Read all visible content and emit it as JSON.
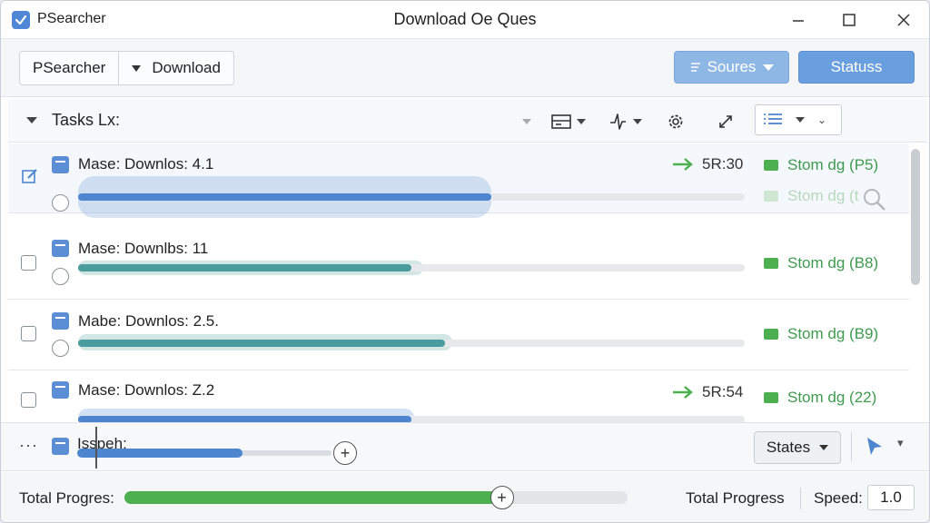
{
  "app": {
    "name": "PSearcher",
    "window_title": "Download Oe Ques"
  },
  "toolbar": {
    "segment": [
      "PSearcher",
      "Download"
    ],
    "sources_label": "Soures",
    "status_label": "Statuss"
  },
  "tasks": {
    "header_label": "Tasks Lx:"
  },
  "rows": [
    {
      "name": "Mase: Downlos: 4.1",
      "progress": 0.62,
      "color": "#4d86cf",
      "eta": "5R:30",
      "status": "Stom dg (P5)",
      "status_secondary": "Stom dg (t"
    },
    {
      "name": "Mase: Downlbs: 11",
      "progress": 0.5,
      "color": "#4a9b9c",
      "status": "Stom dg (B8)"
    },
    {
      "name": "Mabe: Downlos: 2.5.",
      "progress": 0.55,
      "color": "#4a9b9c",
      "status": "Stom dg (B9)"
    },
    {
      "name": "Mase: Downlos: Z.2",
      "progress": 0.5,
      "color": "#4d86cf",
      "eta": "5R:54",
      "status": "Stom dg (22)"
    }
  ],
  "bottom": {
    "more": "···",
    "item_label": "Isspeh:",
    "states_label": "States",
    "item_progress": 0.65
  },
  "footer": {
    "total_label": "Total Progres:",
    "total_progress": 0.75,
    "total_progress_label": "Total Progress",
    "speed_label": "Speed:",
    "speed_value": "1.0"
  },
  "icons": [
    "check-app-icon",
    "minimize-icon",
    "maximize-icon",
    "close-icon",
    "edit-icon",
    "search-icon",
    "grid-icon",
    "bolt-icon",
    "gear-icon",
    "expand-icon",
    "list-icon",
    "arrow-right-icon",
    "cursor-icon",
    "plus-icon"
  ]
}
